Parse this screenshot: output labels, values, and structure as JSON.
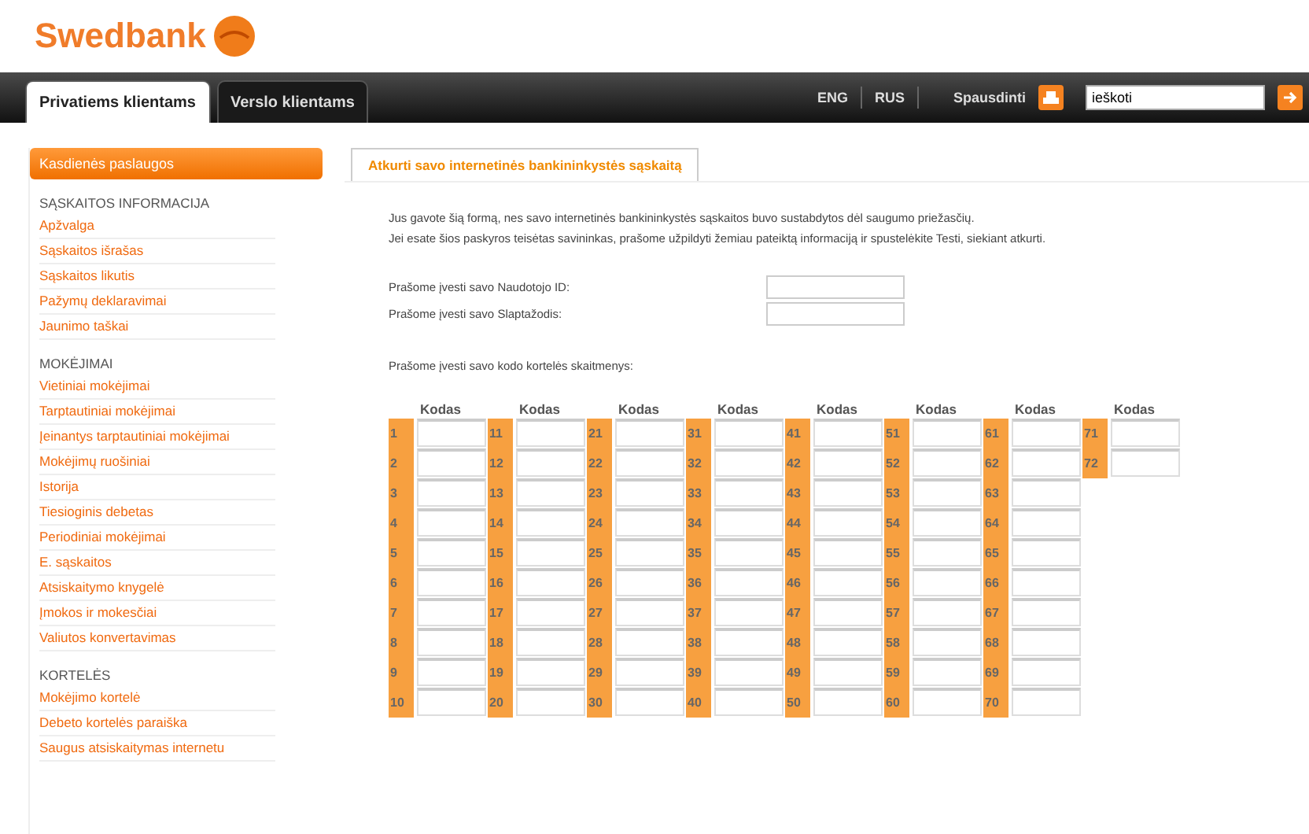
{
  "logo": {
    "text": "Swedbank"
  },
  "nav": {
    "tabs": [
      {
        "label": "Privatiems klientams",
        "selected": true
      },
      {
        "label": "Verslo klientams",
        "selected": false
      }
    ],
    "languages": [
      "ENG",
      "RUS"
    ],
    "print": "Spausdinti",
    "search": {
      "value": "ieškoti"
    }
  },
  "sidebar": {
    "header": "Kasdienės paslaugos",
    "sections": [
      {
        "title": "SĄSKAITOS INFORMACIJA",
        "items": [
          "Apžvalga",
          "Sąskaitos išrašas",
          "Sąskaitos likutis",
          "Pažymų deklaravimai",
          "Jaunimo taškai"
        ]
      },
      {
        "title": "MOKĖJIMAI",
        "items": [
          "Vietiniai mokėjimai",
          "Tarptautiniai mokėjimai",
          "Įeinantys tarptautiniai mokėjimai",
          "Mokėjimų ruošiniai",
          "Istorija",
          "Tiesioginis debetas",
          "Periodiniai mokėjimai",
          "E. sąskaitos",
          "Atsiskaitymo knygelė",
          "Įmokos ir mokesčiai",
          "Valiutos konvertavimas"
        ]
      },
      {
        "title": "KORTELĖS",
        "items": [
          "Mokėjimo kortelė",
          "Debeto kortelės paraiška",
          "Saugus atsiskaitymas internetu"
        ]
      }
    ]
  },
  "content": {
    "tab": "Atkurti savo internetinės bankininkystės sąskaitą",
    "intro": [
      "Jus gavote šią formą, nes savo internetinės bankininkystės sąskaitos buvo sustabdytos dėl saugumo priežasčių.",
      "Jei esate šios paskyros teisėtas savininkas, prašome užpildyti žemiau pateiktą informaciją ir spustelėkite Testi, siekiant atkurti."
    ],
    "fields": [
      {
        "label": "Prašome įvesti savo Naudotojo ID:"
      },
      {
        "label": "Prašome įvesti savo Slaptažodis:"
      }
    ],
    "grid_label": "Prašome įvesti savo kodo kortelės skaitmenys:",
    "code_columns": [
      {
        "header": "Kodas",
        "numbers": [
          "1",
          "2",
          "3",
          "4",
          "5",
          "6",
          "7",
          "8",
          "9",
          "10"
        ]
      },
      {
        "header": "Kodas",
        "numbers": [
          "11",
          "12",
          "13",
          "14",
          "15",
          "16",
          "17",
          "18",
          "19",
          "20"
        ]
      },
      {
        "header": "Kodas",
        "numbers": [
          "21",
          "22",
          "23",
          "24",
          "25",
          "26",
          "27",
          "28",
          "29",
          "30"
        ]
      },
      {
        "header": "Kodas",
        "numbers": [
          "31",
          "32",
          "33",
          "34",
          "35",
          "36",
          "37",
          "38",
          "39",
          "40"
        ]
      },
      {
        "header": "Kodas",
        "numbers": [
          "41",
          "42",
          "43",
          "44",
          "45",
          "46",
          "47",
          "48",
          "49",
          "50"
        ]
      },
      {
        "header": "Kodas",
        "numbers": [
          "51",
          "52",
          "53",
          "54",
          "55",
          "56",
          "57",
          "58",
          "59",
          "60"
        ]
      },
      {
        "header": "Kodas",
        "numbers": [
          "61",
          "62",
          "63",
          "64",
          "65",
          "66",
          "67",
          "68",
          "69",
          "70"
        ]
      },
      {
        "header": "Kodas",
        "numbers": [
          "71",
          "72"
        ]
      }
    ]
  }
}
